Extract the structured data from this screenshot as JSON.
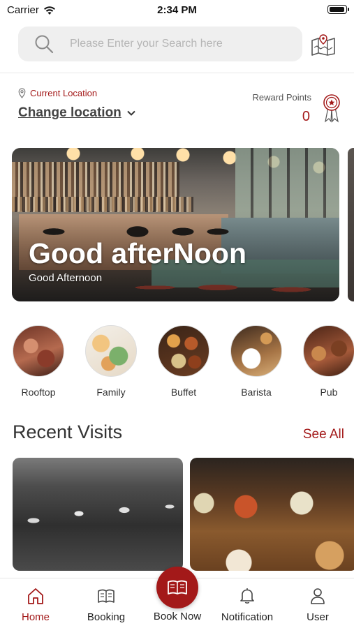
{
  "status_bar": {
    "carrier": "Carrier",
    "time": "2:34 PM"
  },
  "search": {
    "placeholder": "Please Enter your Search here",
    "value": ""
  },
  "location": {
    "label": "Current Location",
    "change_label": "Change location"
  },
  "rewards": {
    "label": "Reward Points",
    "value": "0"
  },
  "banner": {
    "title": "Good afterNoon",
    "subtitle": "Good Afternoon"
  },
  "categories": [
    {
      "label": "Rooftop"
    },
    {
      "label": "Family"
    },
    {
      "label": "Buffet"
    },
    {
      "label": "Barista"
    },
    {
      "label": "Pub"
    }
  ],
  "recent_visits": {
    "title": "Recent Visits",
    "see_all": "See All"
  },
  "bottom_nav": {
    "items": [
      {
        "label": "Home",
        "icon": "home-icon",
        "active": true
      },
      {
        "label": "Booking",
        "icon": "booking-icon",
        "active": false
      },
      {
        "label": "Book Now",
        "icon": "book-now-icon",
        "active": false
      },
      {
        "label": "Notification",
        "icon": "bell-icon",
        "active": false
      },
      {
        "label": "User",
        "icon": "user-icon",
        "active": false
      }
    ]
  },
  "colors": {
    "accent": "#a31919",
    "search_bg": "#efefef",
    "text": "#222222"
  }
}
